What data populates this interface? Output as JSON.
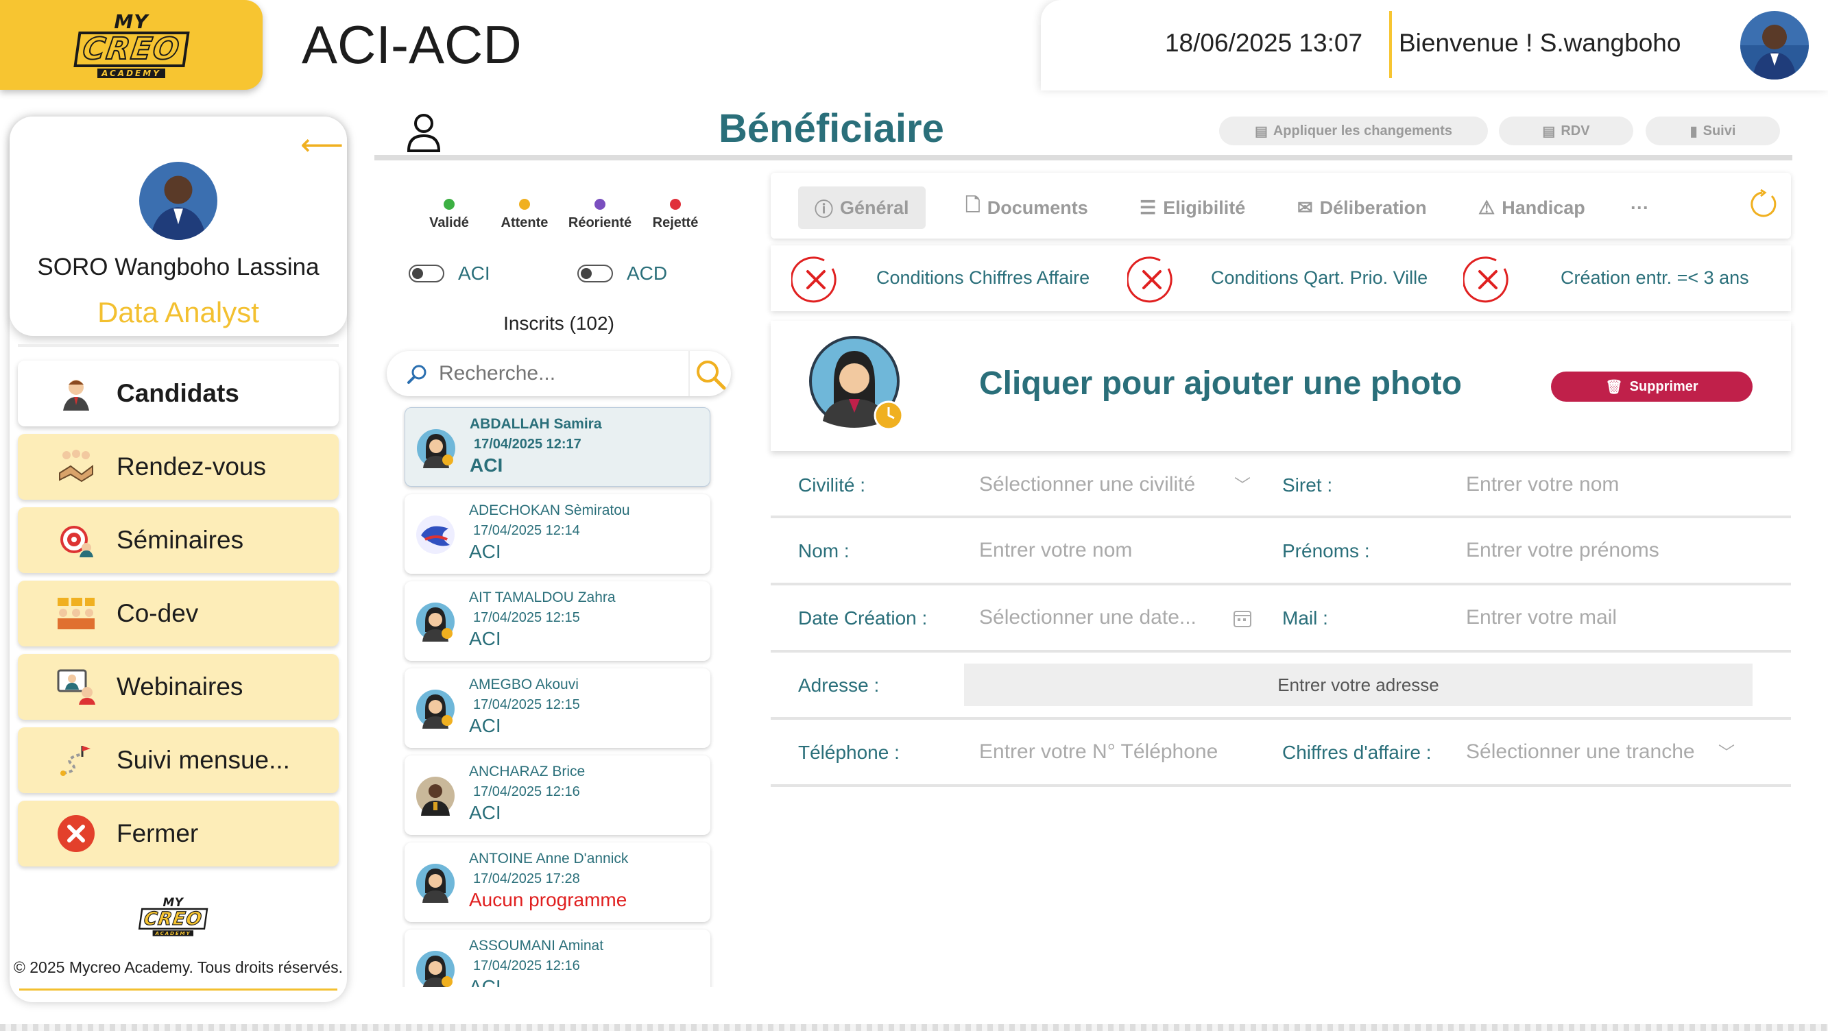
{
  "header": {
    "logo": {
      "my": "MY",
      "creo": "CREO",
      "academy": "ACADEMY"
    },
    "app_title": "ACI-ACD",
    "datetime": "18/06/2025 13:07",
    "welcome": "Bienvenue ! S.wangboho"
  },
  "sidebar": {
    "profile": {
      "name": "SORO Wangboho Lassina",
      "role": "Data Analyst"
    },
    "items": [
      {
        "label": "Candidats",
        "icon": "candidate-icon",
        "active": true
      },
      {
        "label": "Rendez-vous",
        "icon": "handshake-icon"
      },
      {
        "label": "Séminaires",
        "icon": "target-icon"
      },
      {
        "label": "Co-dev",
        "icon": "group-icon"
      },
      {
        "label": "Webinaires",
        "icon": "webinar-icon"
      },
      {
        "label": "Suivi mensue...",
        "icon": "path-flag-icon"
      },
      {
        "label": "Fermer",
        "icon": "close-icon"
      }
    ],
    "copyright": "© 2025 Mycreo Academy. Tous droits réservés."
  },
  "page": {
    "title": "Bénéficiaire",
    "buttons": {
      "apply": "Appliquer les changements",
      "rdv": "RDV",
      "suivi": "Suivi"
    }
  },
  "list": {
    "legend": [
      {
        "label": "Validé",
        "color": "#3CB043"
      },
      {
        "label": "Attente",
        "color": "#F0B020"
      },
      {
        "label": "Réorienté",
        "color": "#7A4FBF"
      },
      {
        "label": "Rejetté",
        "color": "#E0303A"
      }
    ],
    "toggles": {
      "aci": "ACI",
      "acd": "ACD"
    },
    "count_label": "Inscrits (102)",
    "search_placeholder": "Recherche...",
    "candidates": [
      {
        "name": "ABDALLAH Samira",
        "date": "17/04/2025 12:17",
        "program": "ACI"
      },
      {
        "name": "ADECHOKAN Sèmiratou",
        "date": "17/04/2025 12:14",
        "program": "ACI"
      },
      {
        "name": "AIT TAMALDOU Zahra",
        "date": "17/04/2025 12:15",
        "program": "ACI"
      },
      {
        "name": "AMEGBO Akouvi",
        "date": "17/04/2025 12:15",
        "program": "ACI"
      },
      {
        "name": "ANCHARAZ Brice",
        "date": "17/04/2025 12:16",
        "program": "ACI"
      },
      {
        "name": "ANTOINE Anne D'annick",
        "date": "17/04/2025 17:28",
        "program": "Aucun programme"
      },
      {
        "name": "ASSOUMANI Aminat",
        "date": "17/04/2025 12:16",
        "program": "ACI"
      }
    ]
  },
  "detail": {
    "tabs": [
      "Général",
      "Documents",
      "Eligibilité",
      "Déliberation",
      "Handicap",
      "···"
    ],
    "conditions": [
      "Conditions Chiffres Affaire",
      "Conditions Qart. Prio. Ville",
      "Création entr. =< 3 ans"
    ],
    "photo_cta": "Cliquer pour ajouter une photo",
    "delete_label": "Supprimer",
    "fields": {
      "civilite": {
        "label": "Civilité :",
        "placeholder": "Sélectionner une civilité"
      },
      "siret": {
        "label": "Siret :",
        "placeholder": "Entrer votre nom"
      },
      "nom": {
        "label": "Nom :",
        "placeholder": "Entrer votre nom"
      },
      "prenoms": {
        "label": "Prénoms :",
        "placeholder": "Entrer votre prénoms"
      },
      "date_creation": {
        "label": "Date Création :",
        "placeholder": "Sélectionner une date..."
      },
      "mail": {
        "label": "Mail :",
        "placeholder": "Entrer votre mail"
      },
      "adresse": {
        "label": "Adresse :",
        "placeholder": "Entrer votre adresse"
      },
      "telephone": {
        "label": "Téléphone :",
        "placeholder": "Entrer votre N° Téléphone"
      },
      "chiffres": {
        "label": "Chiffres d'affaire :",
        "placeholder": "Sélectionner une tranche"
      }
    }
  }
}
